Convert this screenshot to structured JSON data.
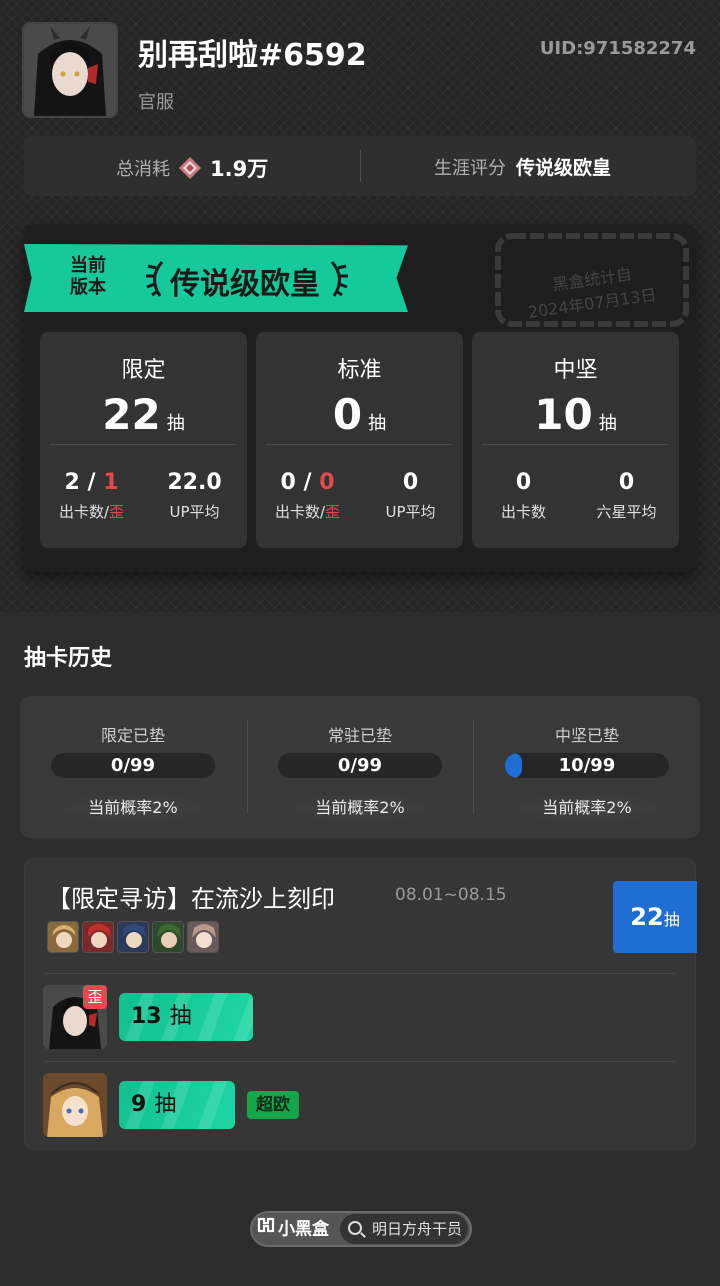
{
  "profile": {
    "username": "别再刮啦#6592",
    "server": "官服",
    "uid": "UID:971582274"
  },
  "stats": {
    "spend_label": "总消耗",
    "spend_icon": "originite-prime-icon",
    "spend_value": "1.9万",
    "rating_label": "生涯评分",
    "rating_value": "传说级欧皇"
  },
  "version_card": {
    "version_label_line1": "当前",
    "version_label_line2": "版本",
    "rating": "传说级欧皇",
    "stamp_line1": "黑盒统计自",
    "stamp_line2": "2024年07月13日",
    "boxes": [
      {
        "title": "限定",
        "count": "22",
        "unit": "抽",
        "left_value_a": "2",
        "left_sep": "/",
        "left_value_b": "1",
        "left_label_a": "出卡数",
        "left_label_sep": "/",
        "left_label_b": "歪",
        "right_value": "22.0",
        "right_label": "UP平均"
      },
      {
        "title": "标准",
        "count": "0",
        "unit": "抽",
        "left_value_a": "0",
        "left_sep": "/",
        "left_value_b": "0",
        "left_label_a": "出卡数",
        "left_label_sep": "/",
        "left_label_b": "歪",
        "right_value": "0",
        "right_label": "UP平均"
      },
      {
        "title": "中坚",
        "count": "10",
        "unit": "抽",
        "left_value": "0",
        "left_label": "出卡数",
        "right_value": "0",
        "right_label": "六星平均"
      }
    ]
  },
  "history": {
    "title": "抽卡历史",
    "pity": [
      {
        "label": "限定已垫",
        "value": "0/99",
        "progress": 0.0,
        "prob": "当前概率2%"
      },
      {
        "label": "常驻已垫",
        "value": "0/99",
        "progress": 0.0,
        "prob": "当前概率2%"
      },
      {
        "label": "中坚已垫",
        "value": "10/99",
        "progress": 0.101,
        "prob": "当前概率2%"
      }
    ]
  },
  "banner": {
    "title": "【限定寻访】在流沙上刻印",
    "date": "08.01~08.15",
    "total": "22",
    "total_unit": "抽",
    "featured_ops": [
      "op-portrait-1",
      "op-portrait-2",
      "op-portrait-3",
      "op-portrait-4",
      "op-portrait-5"
    ],
    "results": [
      {
        "count": "13",
        "unit": "抽",
        "tag": "歪",
        "avatar": "operator-avatar-dark-hair"
      },
      {
        "count": "9",
        "unit": "抽",
        "badge": "超欧",
        "avatar": "operator-avatar-blonde-hat"
      }
    ]
  },
  "footer": {
    "logo": "小黑盒",
    "search_text": "明日方舟干员"
  },
  "colors": {
    "accent_green": "#16c99a",
    "accent_blue": "#1f6ed4",
    "accent_red": "#e5484d",
    "badge_green": "#15a64a"
  }
}
